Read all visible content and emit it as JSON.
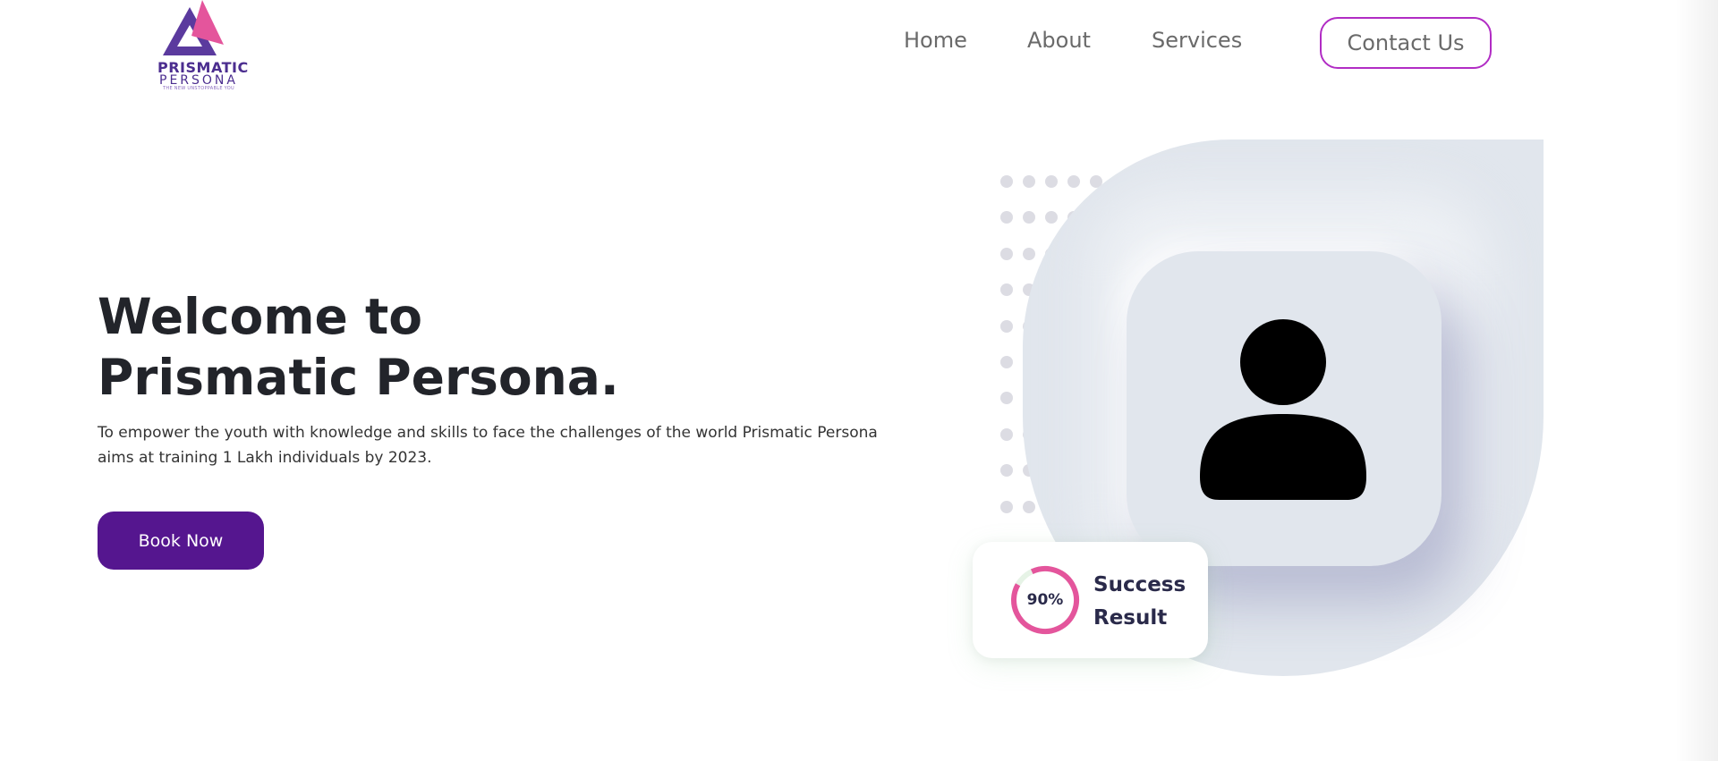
{
  "brand": {
    "name_line1": "PRISMATIC",
    "name_line2": "PERSONA",
    "tagline": "THE NEW UNSTOPPABLE YOU",
    "colors": {
      "purple": "#4b2d8f",
      "pink": "#e4559c",
      "accent": "#55168f",
      "border": "#b12cc4"
    }
  },
  "nav": {
    "items": [
      {
        "label": "Home"
      },
      {
        "label": "About"
      },
      {
        "label": "Services"
      }
    ],
    "contact_label": "Contact Us"
  },
  "hero": {
    "title_line1": "Welcome to",
    "title_line2": "Prismatic Persona.",
    "description": "To empower the youth with knowledge and skills to face the challenges of the world Prismatic Persona aims at training 1 Lakh individuals by 2023.",
    "cta_label": "Book Now"
  },
  "stat_card": {
    "percent_text": "90%",
    "percent_value": 0.9,
    "label_line1": "Success",
    "label_line2": "Result"
  },
  "icons": {
    "avatar": "user-silhouette-icon",
    "ring": "progress-ring-icon"
  }
}
